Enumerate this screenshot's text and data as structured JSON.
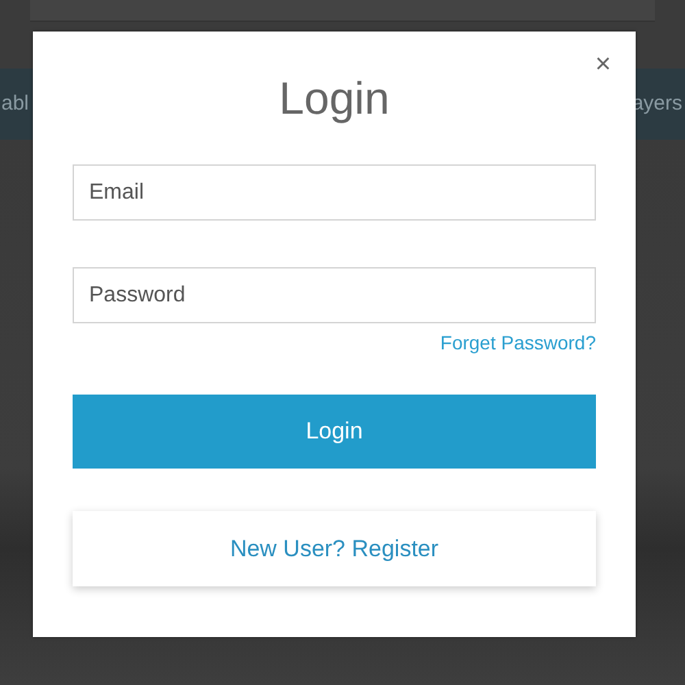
{
  "background": {
    "nav_items": [
      "abl",
      "ayers"
    ]
  },
  "dialog": {
    "title": "Login",
    "close": "×",
    "fields": [
      {
        "placeholder": "Email"
      },
      {
        "placeholder": "Password"
      }
    ],
    "forgot_link": "Forget Password?",
    "login_button": "Login",
    "register_button": "New User? Register"
  }
}
